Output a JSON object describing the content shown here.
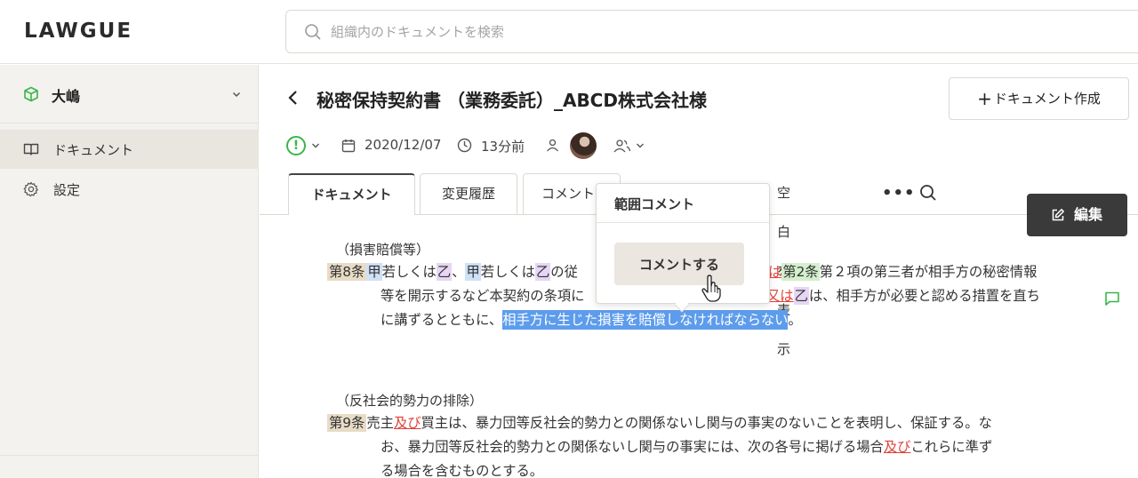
{
  "app": {
    "logo": "LAWGUE"
  },
  "search": {
    "placeholder": "組織内のドキュメントを検索"
  },
  "sidebar": {
    "workspace": "大嶋",
    "items": [
      {
        "label": "ドキュメント",
        "icon": "book-icon",
        "active": true
      },
      {
        "label": "設定",
        "icon": "gear-icon",
        "active": false
      }
    ]
  },
  "document": {
    "title": "秘密保持契約書 （業務委託）_ABCD株式会社様",
    "date": "2020/12/07",
    "updated_ago": "13分前",
    "new_doc_label": "ドキュメント作成"
  },
  "tabs": {
    "doc": "ドキュメント",
    "history": "変更履歴",
    "comment": "コメント",
    "whitespace": "空白を表示"
  },
  "edit_button": "編集",
  "popup": {
    "header": "範囲コメント",
    "button": "コメントする"
  },
  "content": {
    "h1": "（損害賠償等）",
    "a8": {
      "num": "第8条",
      "l1a": "甲",
      "l1b": "若しくは",
      "l1c": "乙",
      "l1d": "、",
      "l1e": "甲",
      "l1f": "若しくは",
      "l1g": "乙",
      "l1h": "の従",
      "l1i": "は",
      "l1j": "第2条",
      "l1k": "第２項の第三者が相手方の秘密情報",
      "l2a": "等を開示するなど本契約の条項に",
      "l2b": "又は",
      "l2c": "乙",
      "l2d": "は、相手方が必要と認める措置を直ち",
      "l3a": "に講ずるとともに、",
      "l3sel": "相手方に生じた損害を賠償しなければならない",
      "l3b": "。"
    },
    "h2": "（反社会的勢力の排除）",
    "a9": {
      "num": "第9条",
      "l1a": "売主",
      "l1b": "及び",
      "l1c": "買主は、暴力団等反社会的勢力との関係ないし関与の事実のないことを表明し、保証する。な",
      "l2a": "お、暴力団等反社会的勢力との関係ないし関与の事実には、次の各号に掲げる場合",
      "l2b": "及び",
      "l2c": "これらに準ず",
      "l3a": "る場合を含むものとする。"
    }
  },
  "colors": {
    "accent_green": "#3ab54a",
    "selection": "#5d9cec",
    "edit_bg": "#3a3a3a"
  }
}
